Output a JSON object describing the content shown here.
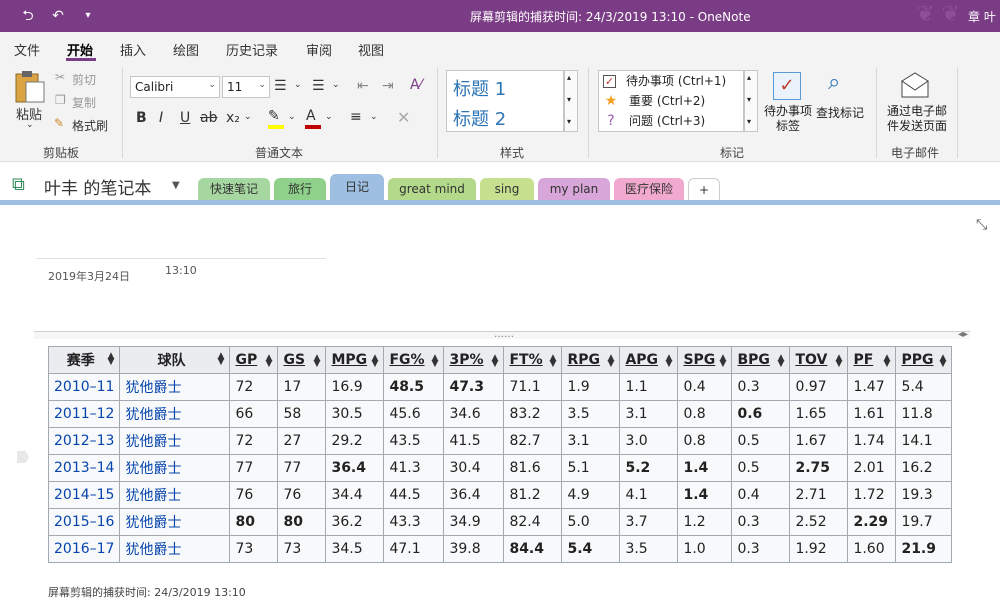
{
  "titlebar": {
    "title": "屏幕剪辑的捕获时间: 24/3/2019 13:10  -  OneNote",
    "user": "章 叶"
  },
  "menu": {
    "tabs": [
      "文件",
      "开始",
      "插入",
      "绘图",
      "历史记录",
      "审阅",
      "视图"
    ],
    "active": "开始"
  },
  "ribbon": {
    "clipboard": {
      "paste": "粘贴",
      "cut": "剪切",
      "copy": "复制",
      "format_painter": "格式刷",
      "label": "剪贴板"
    },
    "basic_text": {
      "font": "Calibri",
      "size": "11",
      "label": "普通文本",
      "font_color": "#c00000",
      "highlight_color": "#ffff00"
    },
    "styles": {
      "items": [
        "标题 1",
        "标题 2"
      ],
      "label": "样式"
    },
    "tags": {
      "items": [
        "待办事项 (Ctrl+1)",
        "重要 (Ctrl+2)",
        "问题 (Ctrl+3)"
      ],
      "todo_tag": "待办事项\n标签",
      "find_tags": "查找标记",
      "label": "标记"
    },
    "email": {
      "send": "通过电子邮\n件发送页面",
      "label": "电子邮件"
    }
  },
  "notebook": {
    "name": "叶丰 的笔记本",
    "sections": [
      {
        "label": "快速笔记",
        "color": "#a7d7a1"
      },
      {
        "label": "旅行",
        "color": "#8fd08a"
      },
      {
        "label": "日记",
        "color": "#9fbfe2"
      },
      {
        "label": "great mind",
        "color": "#b4d98a"
      },
      {
        "label": "sing",
        "color": "#c6e08f"
      },
      {
        "label": "my plan",
        "color": "#d8a6d8"
      },
      {
        "label": "医疗保险",
        "color": "#f1a9cf"
      },
      {
        "label": "+",
        "color": "#ffffff"
      }
    ],
    "active_section": "日记"
  },
  "page": {
    "date": "2019年3月24日",
    "time": "13:10",
    "caption": "屏幕剪辑的捕获时间: 24/3/2019 13:10"
  },
  "table": {
    "headers": [
      "赛季",
      "球队",
      "GP",
      "GS",
      "MPG",
      "FG%",
      "3P%",
      "FT%",
      "RPG",
      "APG",
      "SPG",
      "BPG",
      "TOV",
      "PF",
      "PPG"
    ],
    "rows": [
      [
        "2010–11",
        "犹他爵士",
        "72",
        "17",
        "16.9",
        "48.5",
        "47.3",
        "71.1",
        "1.9",
        "1.1",
        "0.4",
        "0.3",
        "0.97",
        "1.47",
        "5.4"
      ],
      [
        "2011–12",
        "犹他爵士",
        "66",
        "58",
        "30.5",
        "45.6",
        "34.6",
        "83.2",
        "3.5",
        "3.1",
        "0.8",
        "0.6",
        "1.65",
        "1.61",
        "11.8"
      ],
      [
        "2012–13",
        "犹他爵士",
        "72",
        "27",
        "29.2",
        "43.5",
        "41.5",
        "82.7",
        "3.1",
        "3.0",
        "0.8",
        "0.5",
        "1.67",
        "1.74",
        "14.1"
      ],
      [
        "2013–14",
        "犹他爵士",
        "77",
        "77",
        "36.4",
        "41.3",
        "30.4",
        "81.6",
        "5.1",
        "5.2",
        "1.4",
        "0.5",
        "2.75",
        "2.01",
        "16.2"
      ],
      [
        "2014–15",
        "犹他爵士",
        "76",
        "76",
        "34.4",
        "44.5",
        "36.4",
        "81.2",
        "4.9",
        "4.1",
        "1.4",
        "0.4",
        "2.71",
        "1.72",
        "19.3"
      ],
      [
        "2015–16",
        "犹他爵士",
        "80",
        "80",
        "36.2",
        "43.3",
        "34.9",
        "82.4",
        "5.0",
        "3.7",
        "1.2",
        "0.3",
        "2.52",
        "2.29",
        "19.7"
      ],
      [
        "2016–17",
        "犹他爵士",
        "73",
        "73",
        "34.5",
        "47.1",
        "39.8",
        "84.4",
        "5.4",
        "3.5",
        "1.0",
        "0.3",
        "1.92",
        "1.60",
        "21.9"
      ]
    ],
    "bold_cells": [
      [
        0,
        5
      ],
      [
        0,
        6
      ],
      [
        1,
        11
      ],
      [
        3,
        4
      ],
      [
        3,
        9
      ],
      [
        3,
        10
      ],
      [
        3,
        12
      ],
      [
        4,
        10
      ],
      [
        5,
        2
      ],
      [
        5,
        3
      ],
      [
        5,
        13
      ],
      [
        6,
        7
      ],
      [
        6,
        8
      ],
      [
        6,
        14
      ]
    ]
  }
}
